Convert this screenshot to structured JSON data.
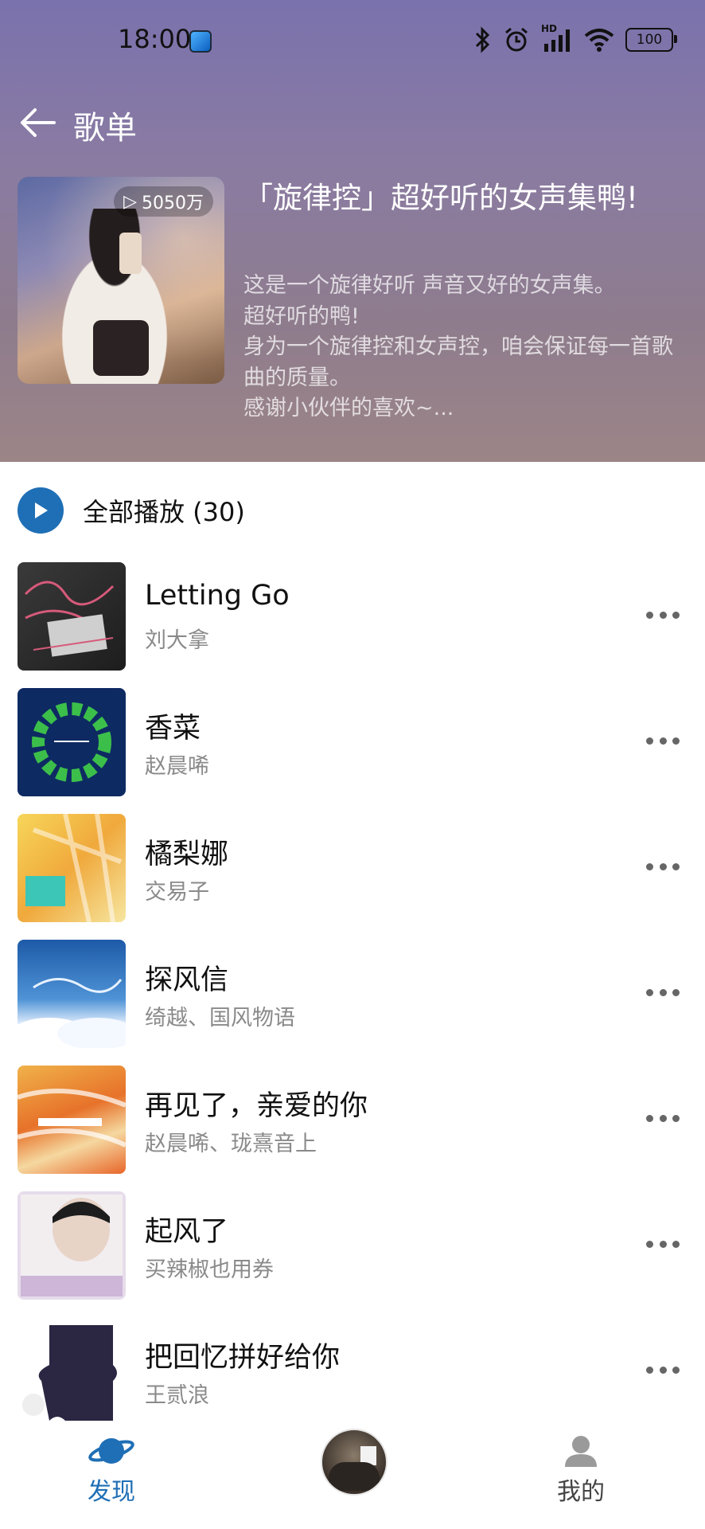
{
  "status_bar": {
    "time": "18:00",
    "battery": "100",
    "network_badge": "HD"
  },
  "header": {
    "title": "歌单"
  },
  "playlist": {
    "play_count": "5050万",
    "title": "「旋律控」超好听的女声集鸭!",
    "description": "这是一个旋律好听 声音又好的女声集。\n超好听的鸭!\n身为一个旋律控和女声控，咱会保证每一首歌曲的质量。\n感谢小伙伴的喜欢~..."
  },
  "play_all": {
    "label": "全部播放 (30)"
  },
  "songs": [
    {
      "title": "Letting Go",
      "artist": "刘大拿",
      "art_color": "#2a2a2a"
    },
    {
      "title": "香菜",
      "artist": "赵晨唏",
      "art_color": "#0e2a63"
    },
    {
      "title": "橘梨娜",
      "artist": "交易子",
      "art_color": "#f3c13b"
    },
    {
      "title": "探风信",
      "artist": "绮越、国风物语",
      "art_color": "#2d6fb3"
    },
    {
      "title": "再见了，亲爱的你",
      "artist": "赵晨唏、珑熹音上",
      "art_color": "#e8742a"
    },
    {
      "title": "起风了",
      "artist": "买辣椒也用券",
      "art_color": "#d8cfe2"
    },
    {
      "title": "把回忆拼好给你",
      "artist": "王贰浪",
      "art_color": "#2b2642"
    }
  ],
  "tabs": {
    "discover": "发现",
    "mine": "我的"
  },
  "colors": {
    "accent": "#1f6fb6"
  }
}
